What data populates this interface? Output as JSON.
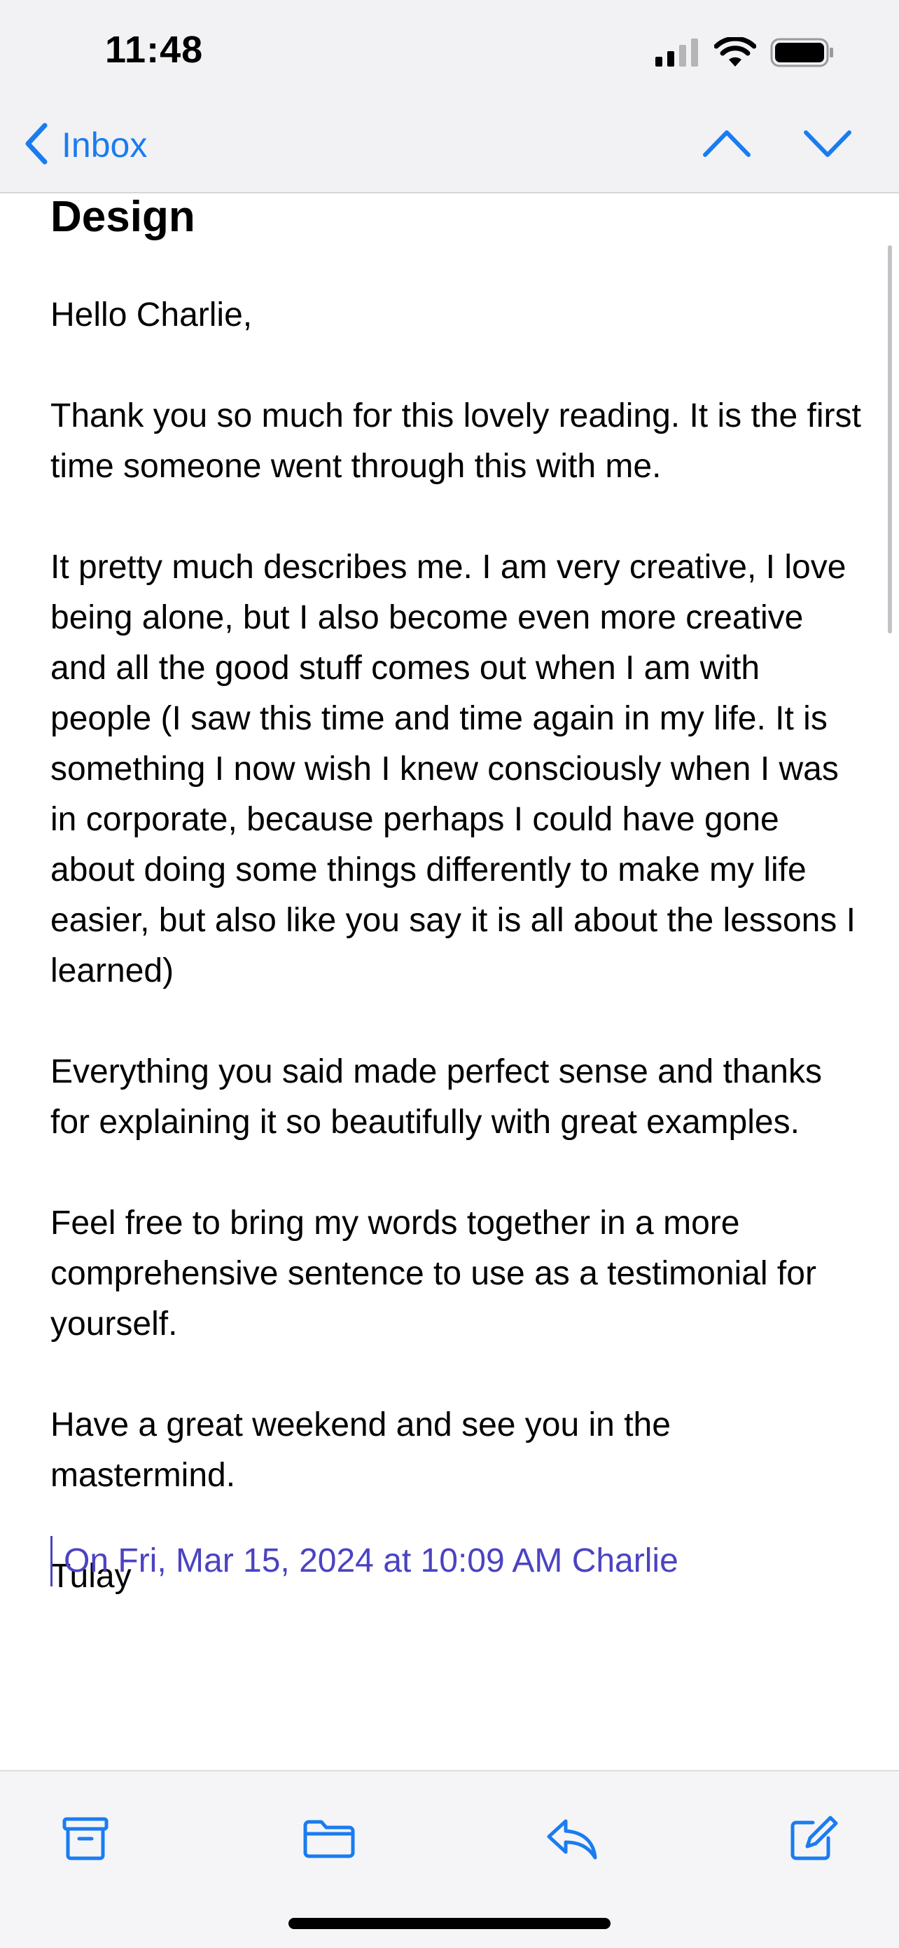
{
  "status_bar": {
    "time": "11:48",
    "icons": [
      "cellular-signal-icon",
      "wifi-icon",
      "battery-icon"
    ]
  },
  "nav": {
    "back_label": "Inbox",
    "back_icon": "chevron-left-icon",
    "prev_icon": "chevron-up-icon",
    "next_icon": "chevron-down-icon"
  },
  "email": {
    "subject": "Design",
    "paragraphs": [
      "Hello Charlie,",
      "Thank you so much for this lovely reading. It is the first time someone went through this with me.",
      "It pretty much describes me. I am very creative, I love being alone, but I also become even more creative and all the good stuff comes out when I am with people (I saw this time and time again in my life. It is something I now wish I knew consciously when I was in corporate, because perhaps I could have gone about doing some things differently to make my life easier, but also like you say it is all about the lessons I learned)",
      "Everything you said made perfect sense and thanks for explaining it so beautifully with great examples.",
      "Feel free to bring my words together in a more comprehensive sentence to use as a testimonial for yourself.",
      "Have a great weekend and see you in the mastermind.",
      "Tulay"
    ],
    "quote_header": "On Fri, Mar 15, 2024 at 10:09 AM Charlie"
  },
  "toolbar": {
    "items": [
      "archive-icon",
      "folder-icon",
      "reply-icon",
      "compose-icon"
    ]
  },
  "colors": {
    "accent": "#1a7cf0",
    "quote": "#4b43c2",
    "bar_background": "#f2f2f4"
  }
}
